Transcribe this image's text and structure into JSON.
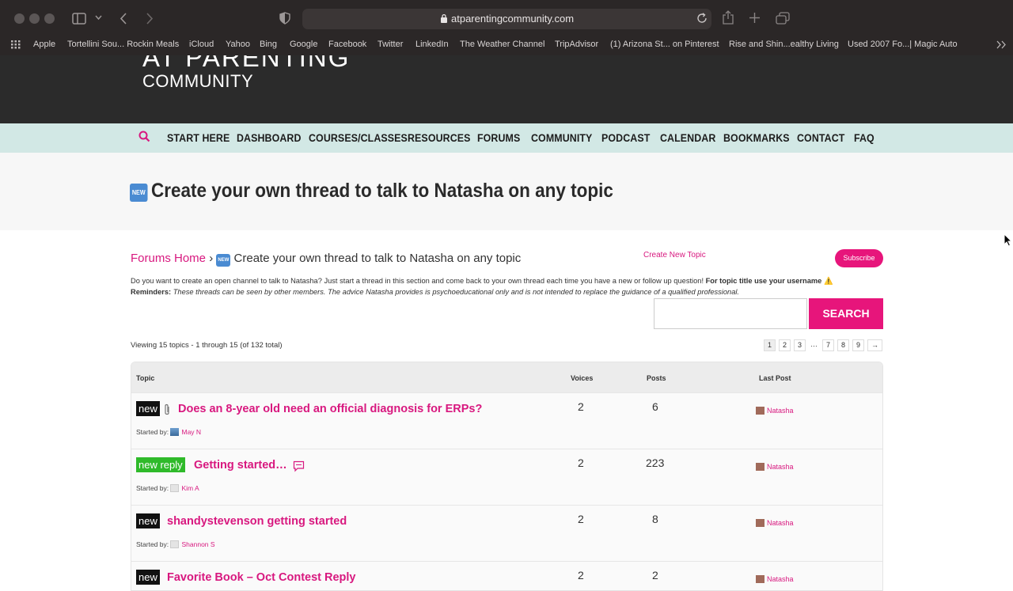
{
  "browser": {
    "url": "atparentingcommunity.com",
    "bookmarks": [
      "Apple",
      "Tortellini Sou... Rockin Meals",
      "iCloud",
      "Yahoo",
      "Bing",
      "Google",
      "Facebook",
      "Twitter",
      "LinkedIn",
      "The Weather Channel",
      "TripAdvisor",
      "(1) Arizona St... on Pinterest",
      "Rise and Shin...ealthy Living",
      "Used 2007 Fo...| Magic Auto"
    ]
  },
  "site": {
    "logo_top": "AT PARENTING",
    "logo_bottom": "COMMUNITY"
  },
  "nav": {
    "items": [
      "START HERE",
      "DASHBOARD",
      "COURSES/CLASSES",
      "RESOURCES",
      "FORUMS",
      "COMMUNITY",
      "PODCAST",
      "CALENDAR",
      "BOOKMARKS",
      "CONTACT",
      "FAQ"
    ]
  },
  "forum": {
    "new_emoji": "NEW",
    "title": "Create your own thread to talk to Natasha on any topic",
    "breadcrumb_home": "Forums Home",
    "breadcrumb_sep": "›",
    "create_topic": "Create New Topic",
    "subscribe": "Subscribe",
    "desc_main": "Do you want to create an open channel to talk to Natasha? Just start a thread in this section and come back to your own thread each time you have a new or follow up question! ",
    "desc_bold": "For topic title use your username",
    "desc_warn": "⚠️",
    "reminders_label": "Reminders:",
    "reminders_text": " These threads can be seen by other members. The advice Natasha provides is psychoeducational only and is not intended to replace the guidance of a qualified professional.",
    "search_button": "SEARCH",
    "viewing": "Viewing 15 topics - 1 through 15 (of 132 total)",
    "pages": [
      "1",
      "2",
      "3",
      "…",
      "7",
      "8",
      "9",
      "→"
    ]
  },
  "table": {
    "headers": {
      "topic": "Topic",
      "voices": "Voices",
      "posts": "Posts",
      "last_post": "Last Post"
    },
    "started_by": "Started by:",
    "rows": [
      {
        "badge": "new",
        "title": "Does an 8-year old need an official diagnosis for ERPs?",
        "author": "May N",
        "voices": "2",
        "posts": "6",
        "last": "Natasha"
      },
      {
        "badge": "new reply",
        "title": "Getting started…",
        "author": "Kim A",
        "voices": "2",
        "posts": "223",
        "last": "Natasha"
      },
      {
        "badge": "new",
        "title": "shandystevenson getting started",
        "author": "Shannon S",
        "voices": "2",
        "posts": "8",
        "last": "Natasha"
      },
      {
        "badge": "new",
        "title": "Favorite Book – Oct Contest Reply",
        "author": "",
        "voices": "2",
        "posts": "2",
        "last": "Natasha"
      }
    ]
  },
  "colors": {
    "accent": "#d8187f",
    "nav_bg": "#d2e8e5",
    "header_bg": "#2b2b2b"
  }
}
